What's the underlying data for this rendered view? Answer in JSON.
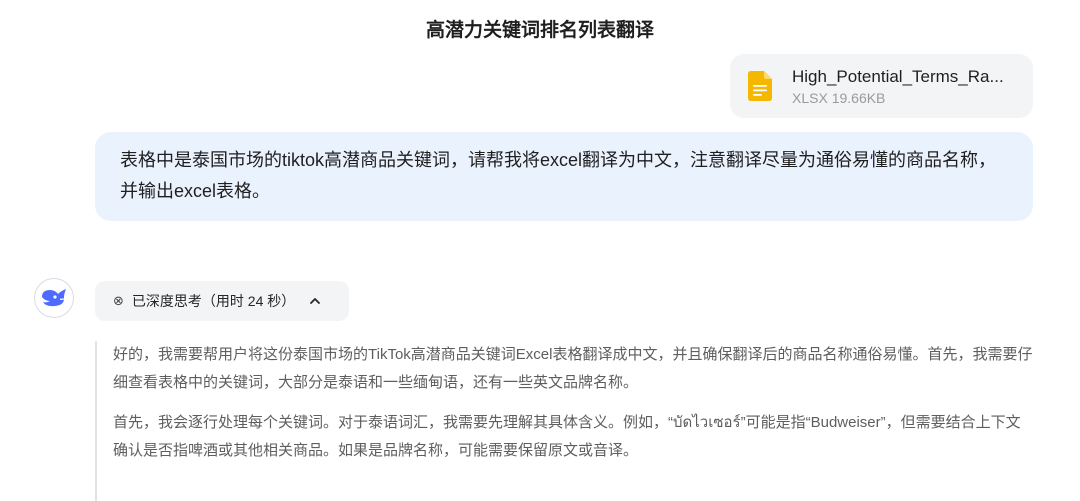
{
  "conversation": {
    "title": "高潜力关键词排名列表翻译"
  },
  "attachment": {
    "file_name": "High_Potential_Terms_Ra...",
    "file_size": "XLSX 19.66KB",
    "icon": "spreadsheet-file-icon",
    "icon_color": "#f5b800"
  },
  "user_message": {
    "text": "表格中是泰国市场的tiktok高潜商品关键词，请帮我将excel翻译为中文，注意翻译尽量为通俗易懂的商品名称，并输出excel表格。",
    "bubble_color": "#eaf2fe"
  },
  "assistant": {
    "avatar_icon": "whale-logo-icon",
    "brand_color": "#4d6bfe",
    "thinking_toggle_label": "已深度思考（用时 24 秒）",
    "thinking_paragraphs": [
      "好的，我需要帮用户将这份泰国市场的TikTok高潜商品关键词Excel表格翻译成中文，并且确保翻译后的商品名称通俗易懂。首先，我需要仔细查看表格中的关键词，大部分是泰语和一些缅甸语，还有一些英文品牌名称。",
      "首先，我会逐行处理每个关键词。对于泰语词汇，我需要先理解其具体含义。例如，“บัดไวเซอร์”可能是指“Budweiser”，但需要结合上下文确认是否指啤酒或其他相关商品。如果是品牌名称，可能需要保留原文或音译。"
    ]
  }
}
